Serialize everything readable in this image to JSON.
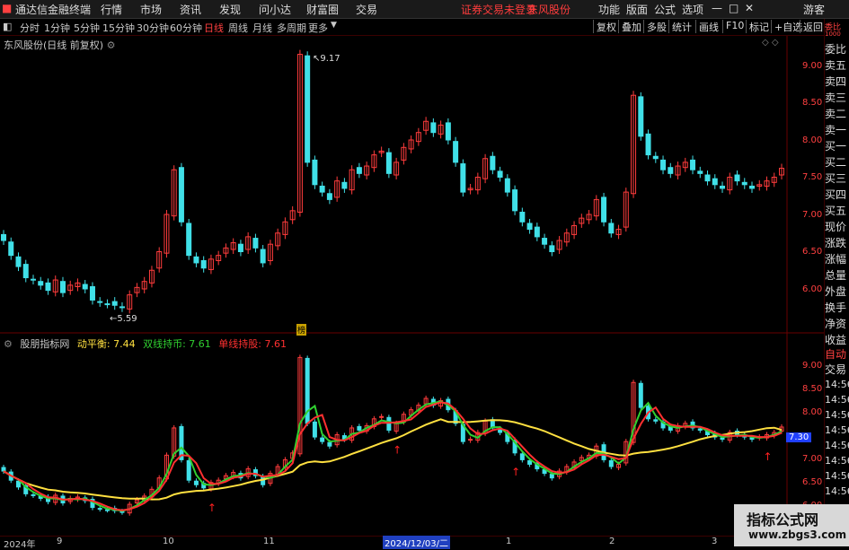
{
  "menubar": {
    "app_title": "通达信金融终端",
    "menu": [
      "行情",
      "市场",
      "资讯",
      "发现",
      "问小达",
      "财富圈",
      "交易"
    ],
    "notice": "证券交易未登录",
    "stock_name": "东风股份",
    "right_menu": [
      "功能",
      "版面",
      "公式",
      "选项"
    ],
    "guest": "游客",
    "window_controls": [
      "—",
      "□",
      "✕"
    ]
  },
  "periodbar": {
    "periods": [
      "分时",
      "1分钟",
      "5分钟",
      "15分钟",
      "30分钟",
      "60分钟",
      "日线",
      "周线",
      "月线",
      "多周期",
      "更多"
    ],
    "active": "日线",
    "tools": [
      "复权",
      "叠加",
      "多股",
      "统计",
      "画线",
      "F10",
      "标记",
      "+自选",
      "返回"
    ]
  },
  "main_chart": {
    "title": "东风股份(日线 前复权)",
    "high_label": "9.17",
    "low_label": "5.59",
    "tag": "榜",
    "y_ticks": [
      "9.00",
      "8.50",
      "8.00",
      "7.50",
      "7.00",
      "6.50",
      "6.00"
    ],
    "top_tick": "9.2"
  },
  "indicator": {
    "name": "股朋指标网",
    "line1_label": "动平衡: 7.44",
    "line2_label": "双线持币: 7.61",
    "line3_label": "单线持股: 7.61",
    "y_ticks": [
      "9.00",
      "8.50",
      "8.00",
      "7.50",
      "7.00",
      "6.50",
      "6.00"
    ],
    "current_value": "7.30",
    "cutoff_ticks": [
      "14:56",
      "14:56",
      "14:56",
      "14:56",
      "14:56",
      "14:56",
      "14:56",
      "14:56"
    ]
  },
  "right_panel": {
    "top_label": "委比",
    "top_small": "1000",
    "items": [
      "委比",
      "卖五",
      "卖四",
      "卖三",
      "卖二",
      "卖一",
      "买一",
      "买二",
      "买三",
      "买四",
      "买五",
      "现价",
      "涨跌",
      "涨幅",
      "总量",
      "外盘",
      "换手",
      "净资",
      "收益"
    ],
    "auto": "自动",
    "trade": "交易"
  },
  "x_axis": {
    "labels": [
      "2024年",
      "9",
      "10",
      "11",
      "2024/12/03/二",
      "1",
      "2",
      "3"
    ]
  },
  "watermark": {
    "title": "指标公式网",
    "url": "www.zbgs3.com"
  },
  "colors": {
    "up": "#ff3c3c",
    "down": "#40e0e8",
    "line_red": "#ff3030",
    "line_green": "#30d030",
    "line_yellow": "#ffe040"
  },
  "chart_data": {
    "type": "candlestick",
    "ylim": [
      5.5,
      9.25
    ],
    "close": [
      6.65,
      6.45,
      6.3,
      6.15,
      6.12,
      6.05,
      5.98,
      6.12,
      5.95,
      6.05,
      6.08,
      6.0,
      5.85,
      5.82,
      5.8,
      5.78,
      5.75,
      5.92,
      6.02,
      6.1,
      6.25,
      6.5,
      7.0,
      7.6,
      6.9,
      6.45,
      6.35,
      6.28,
      6.4,
      6.45,
      6.55,
      6.62,
      6.5,
      6.7,
      6.55,
      6.35,
      6.6,
      6.75,
      6.9,
      7.05,
      9.15,
      7.7,
      7.4,
      7.3,
      7.2,
      7.45,
      7.35,
      7.6,
      7.55,
      7.65,
      7.8,
      7.85,
      7.55,
      7.7,
      7.9,
      8.0,
      8.1,
      8.25,
      8.1,
      8.2,
      8.0,
      7.7,
      7.3,
      7.35,
      7.5,
      7.75,
      7.6,
      7.5,
      7.3,
      7.05,
      6.9,
      6.8,
      6.7,
      6.6,
      6.5,
      6.65,
      6.75,
      6.85,
      6.95,
      7.0,
      7.2,
      6.9,
      6.75,
      6.8,
      7.3,
      8.6,
      8.05,
      7.8,
      7.75,
      7.6,
      7.55,
      7.65,
      7.7,
      7.6,
      7.55,
      7.45,
      7.4,
      7.35,
      7.5,
      7.45,
      7.4,
      7.35,
      7.4,
      7.45,
      7.5,
      7.62
    ]
  }
}
